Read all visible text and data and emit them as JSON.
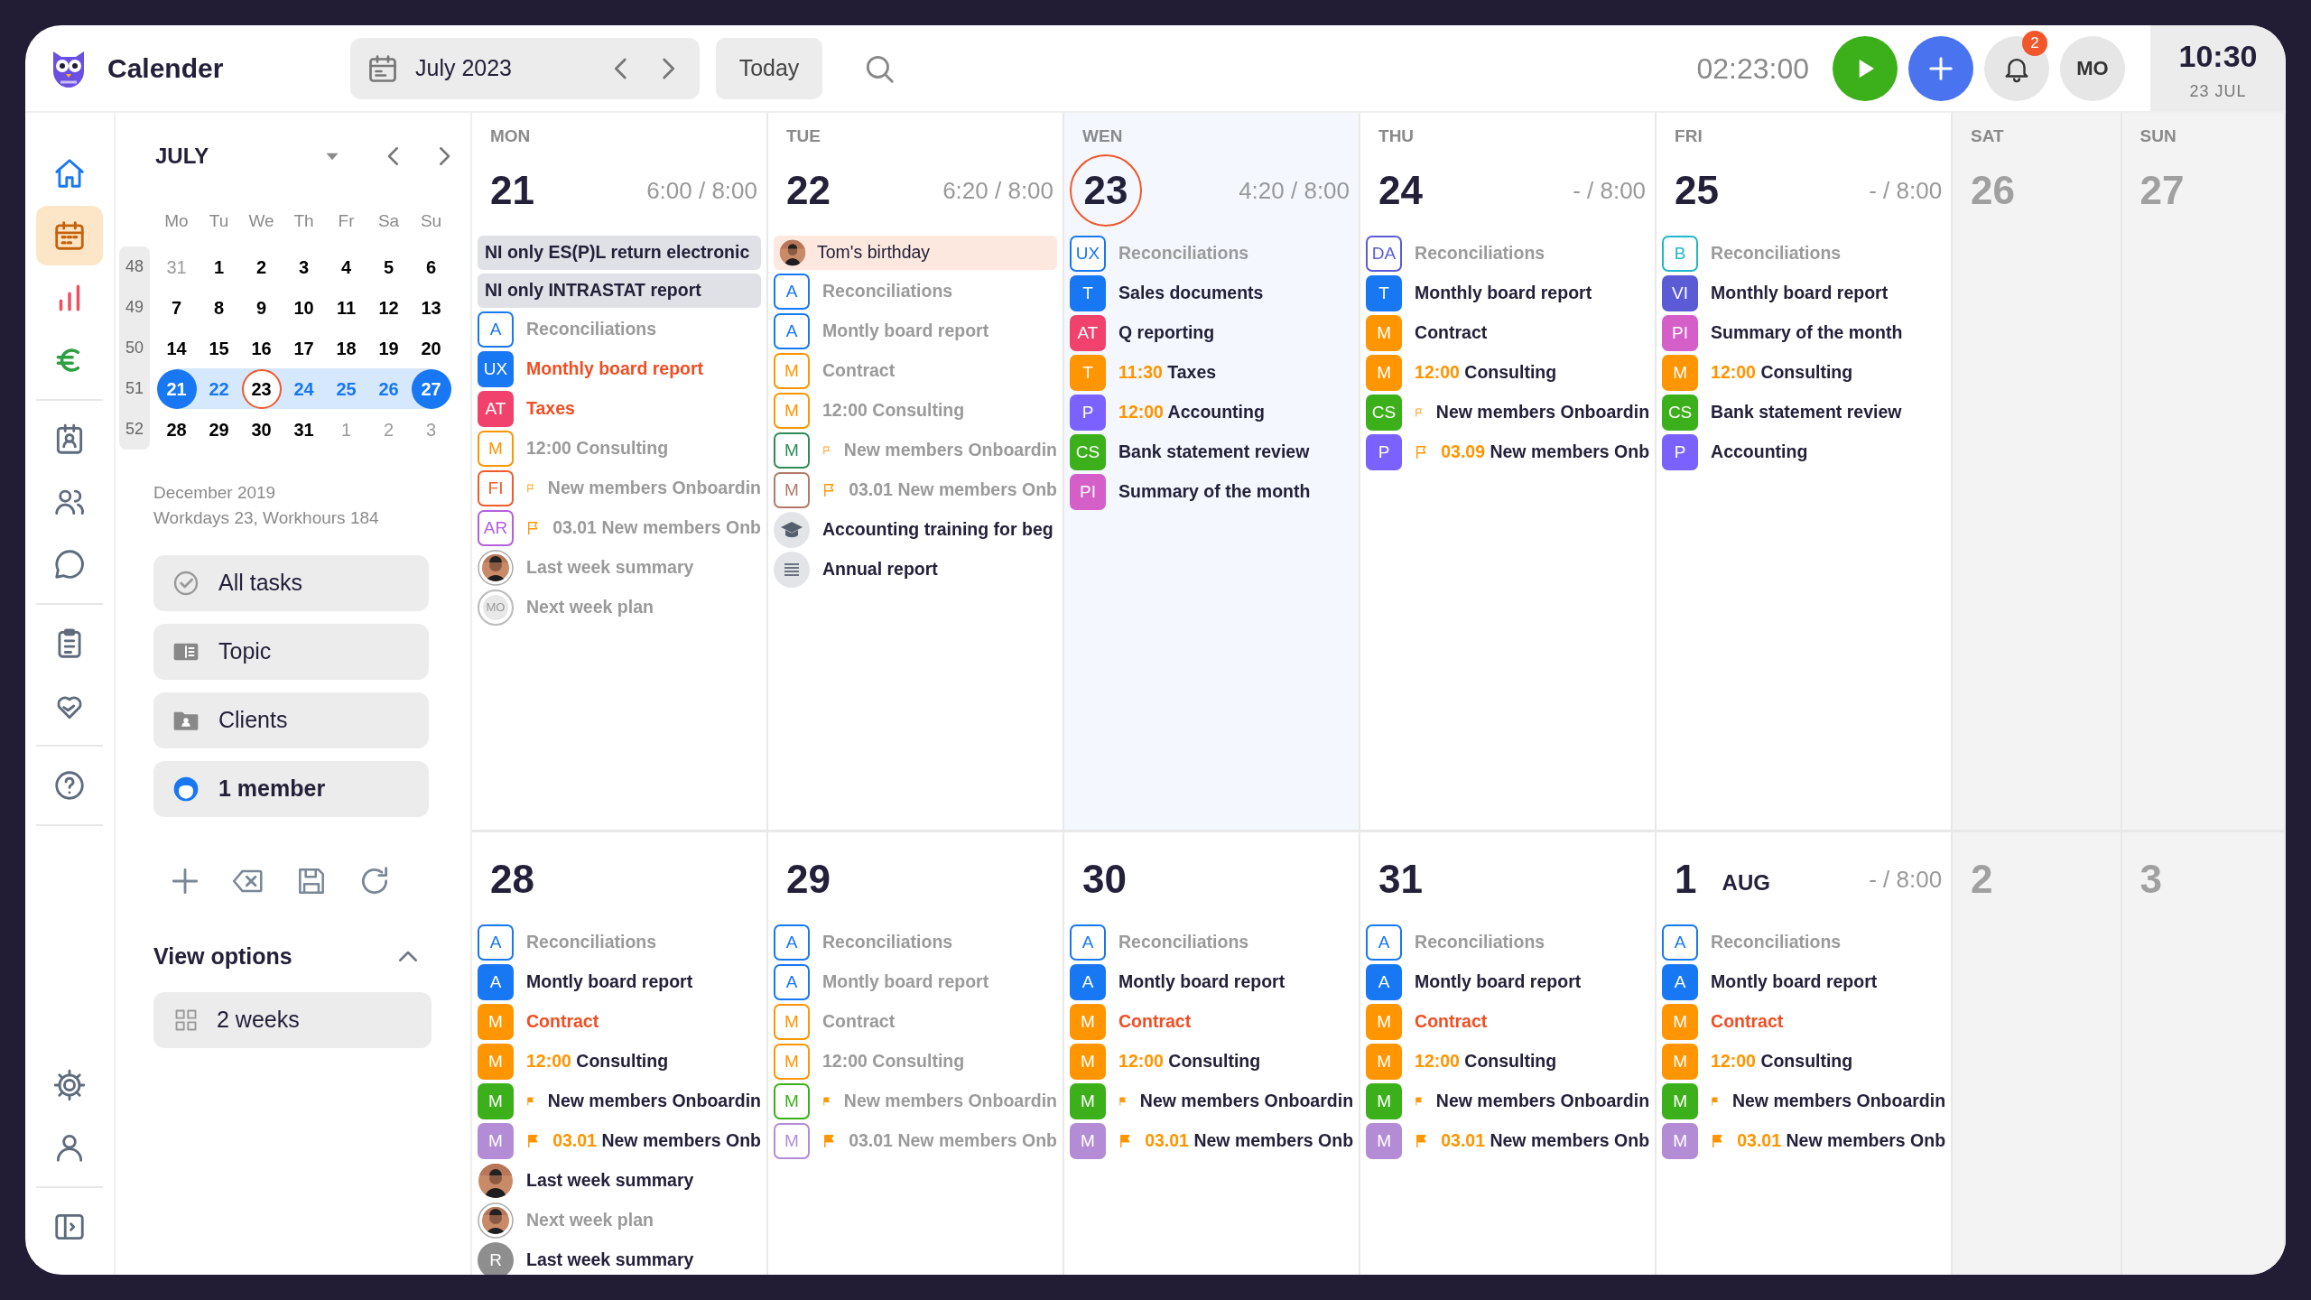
{
  "topbar": {
    "app_title": "Calender",
    "date_picker": "July 2023",
    "today_button": "Today",
    "timer": "02:23:00",
    "notification_count": "2",
    "user_initials": "MO",
    "clock": {
      "time": "10:30",
      "date": "23 JUL"
    }
  },
  "rail": {
    "groups": [
      [
        {
          "selected": false
        },
        {
          "selected": true
        },
        {
          "selected": false
        },
        {
          "selected": false
        }
      ],
      [
        {
          "selected": false
        },
        {
          "selected": false
        },
        {
          "selected": false
        }
      ],
      [
        {
          "selected": false
        },
        {
          "selected": false
        }
      ],
      [
        {
          "selected": false
        }
      ],
      [
        {
          "selected": false
        },
        {
          "selected": false
        }
      ],
      [
        {
          "selected": false
        }
      ]
    ]
  },
  "mini_calendar": {
    "month": "JULY",
    "weekdays": [
      "Mo",
      "Tu",
      "We",
      "Th",
      "Fr",
      "Sa",
      "Su"
    ],
    "weeks": [
      {
        "number": "48",
        "days": [
          {
            "label": "31",
            "kind": "outside"
          },
          {
            "label": "1",
            "kind": "plain"
          },
          {
            "label": "2",
            "kind": "plain"
          },
          {
            "label": "3",
            "kind": "plain"
          },
          {
            "label": "4",
            "kind": "plain"
          },
          {
            "label": "5",
            "kind": "plain"
          },
          {
            "label": "6",
            "kind": "plain"
          }
        ]
      },
      {
        "number": "49",
        "days": [
          {
            "label": "7",
            "kind": "plain"
          },
          {
            "label": "8",
            "kind": "plain"
          },
          {
            "label": "9",
            "kind": "plain"
          },
          {
            "label": "10",
            "kind": "plain"
          },
          {
            "label": "11",
            "kind": "plain"
          },
          {
            "label": "12",
            "kind": "plain"
          },
          {
            "label": "13",
            "kind": "plain"
          }
        ]
      },
      {
        "number": "50",
        "days": [
          {
            "label": "14",
            "kind": "plain"
          },
          {
            "label": "15",
            "kind": "plain"
          },
          {
            "label": "16",
            "kind": "plain"
          },
          {
            "label": "17",
            "kind": "plain"
          },
          {
            "label": "18",
            "kind": "plain"
          },
          {
            "label": "19",
            "kind": "plain"
          },
          {
            "label": "20",
            "kind": "plain"
          }
        ]
      },
      {
        "number": "51",
        "days": [
          {
            "label": "21",
            "kind": "end"
          },
          {
            "label": "22",
            "kind": "range"
          },
          {
            "label": "23",
            "kind": "today"
          },
          {
            "label": "24",
            "kind": "range"
          },
          {
            "label": "25",
            "kind": "range"
          },
          {
            "label": "26",
            "kind": "range"
          },
          {
            "label": "27",
            "kind": "end"
          }
        ]
      },
      {
        "number": "52",
        "days": [
          {
            "label": "28",
            "kind": "plain"
          },
          {
            "label": "29",
            "kind": "plain"
          },
          {
            "label": "30",
            "kind": "plain"
          },
          {
            "label": "31",
            "kind": "plain"
          },
          {
            "label": "1",
            "kind": "outside"
          },
          {
            "label": "2",
            "kind": "outside"
          },
          {
            "label": "3",
            "kind": "outside"
          }
        ]
      }
    ],
    "summary": [
      "December 2019",
      "Workdays 23, Workhours 184"
    ]
  },
  "filters": [
    {
      "label": "All tasks",
      "active": false
    },
    {
      "label": "Topic",
      "active": false
    },
    {
      "label": "Clients",
      "active": false
    },
    {
      "label": "1 member",
      "active": true
    }
  ],
  "view_options": {
    "title": "View options",
    "expanded": true,
    "options": [
      "2 weeks"
    ]
  },
  "weeks": [
    {
      "days": [
        {
          "dow": "MON",
          "number": "21",
          "hours": "6:00 / 8:00",
          "kind": "weekday",
          "today": false,
          "items": [
            {
              "kind": "banner",
              "text": "NI only ES(P)L return electronic"
            },
            {
              "kind": "banner",
              "text": "NI only INTRASTAT report"
            },
            {
              "kind": "task",
              "badge": "A",
              "color": "#1877f2",
              "outlined": true,
              "text": "Reconciliations",
              "done": true,
              "urgent": false
            },
            {
              "kind": "task",
              "badge": "UX",
              "color": "#1877f2",
              "outlined": false,
              "text": "Monthly board report",
              "done": false,
              "urgent": true
            },
            {
              "kind": "task",
              "badge": "AT",
              "color": "#f0426d",
              "outlined": false,
              "text": "Taxes",
              "done": false,
              "urgent": true
            },
            {
              "kind": "task",
              "badge": "M",
              "color": "#ff9500",
              "outlined": true,
              "time": "12:00",
              "text": "Consulting",
              "done": true,
              "urgent": false
            },
            {
              "kind": "task",
              "badge": "FI",
              "color": "#f25a2b",
              "outlined": true,
              "flag": {
                "filled": false
              },
              "text": "New members Onboardin",
              "done": true,
              "urgent": false
            },
            {
              "kind": "task",
              "badge": "AR",
              "color": "#b45fe0",
              "outlined": true,
              "flag": {
                "filled": false
              },
              "time": "03.01",
              "text": "New members Onb",
              "done": true,
              "urgent": false
            },
            {
              "ringed": true,
              "text": "Last week summary",
              "done": true,
              "urgent": false
            },
            {
              "kind": "initials",
              "badge": "MO",
              "outlined": true,
              "text": "Next week plan",
              "done": true,
              "urgent": false
            }
          ]
        },
        {
          "dow": "TUE",
          "number": "22",
          "hours": "6:20 / 8:00",
          "kind": "weekday",
          "today": false,
          "items": [
            {
              "kind": "birthday",
              "text": "Tom's birthday"
            },
            {
              "kind": "task",
              "badge": "A",
              "color": "#1877f2",
              "outlined": true,
              "text": "Reconciliations",
              "done": true,
              "urgent": false
            },
            {
              "kind": "task",
              "badge": "A",
              "color": "#1877f2",
              "outlined": true,
              "text": "Montly board report",
              "done": true,
              "urgent": false
            },
            {
              "kind": "task",
              "badge": "M",
              "color": "#ff9500",
              "outlined": true,
              "text": "Contract",
              "done": true,
              "urgent": false
            },
            {
              "kind": "task",
              "badge": "M",
              "color": "#ff9500",
              "outlined": true,
              "time": "12:00",
              "text": "Consulting",
              "done": true,
              "urgent": false
            },
            {
              "kind": "task",
              "badge": "M",
              "color": "#2e8b57",
              "outlined": true,
              "flag": {
                "filled": false
              },
              "text": "New members Onboardin",
              "done": true,
              "urgent": false
            },
            {
              "kind": "task",
              "badge": "M",
              "color": "#b07a6a",
              "outlined": true,
              "flag": {
                "filled": false
              },
              "time": "03.01",
              "text": "New members Onb",
              "done": true,
              "urgent": false
            },
            {
              "kind": "course",
              "text": "Accounting training for beg",
              "done": false,
              "urgent": false
            },
            {
              "kind": "note",
              "text": "Annual report",
              "done": false,
              "urgent": false
            }
          ]
        },
        {
          "dow": "WEN",
          "number": "23",
          "hours": "4:20 / 8:00",
          "kind": "weekday",
          "today": true,
          "items": [
            {
              "kind": "task",
              "badge": "UX",
              "color": "#1877f2",
              "outlined": true,
              "text": "Reconciliations",
              "done": true,
              "urgent": false
            },
            {
              "kind": "task",
              "badge": "T",
              "color": "#1877f2",
              "outlined": false,
              "text": "Sales documents",
              "done": false,
              "urgent": false
            },
            {
              "kind": "task",
              "badge": "AT",
              "color": "#f0426d",
              "outlined": false,
              "text": "Q reporting",
              "done": false,
              "urgent": false
            },
            {
              "kind": "task",
              "badge": "T",
              "color": "#ff9500",
              "outlined": false,
              "time": "11:30",
              "text": "Taxes",
              "done": false,
              "urgent": false
            },
            {
              "kind": "task",
              "badge": "P",
              "color": "#7b61ff",
              "outlined": false,
              "time": "12:00",
              "text": "Accounting",
              "done": false,
              "urgent": false
            },
            {
              "kind": "task",
              "badge": "CS",
              "color": "#3cb01a",
              "outlined": false,
              "text": "Bank statement review",
              "done": false,
              "urgent": false
            },
            {
              "kind": "task",
              "badge": "PI",
              "color": "#d55fc9",
              "outlined": false,
              "text": "Summary of the month",
              "done": false,
              "urgent": false
            }
          ]
        },
        {
          "dow": "THU",
          "number": "24",
          "hours": "- / 8:00",
          "kind": "weekday",
          "today": false,
          "items": [
            {
              "kind": "task",
              "badge": "DA",
              "color": "#5b5bd6",
              "outlined": true,
              "text": "Reconciliations",
              "done": true,
              "urgent": false
            },
            {
              "kind": "task",
              "badge": "T",
              "color": "#1877f2",
              "outlined": false,
              "text": "Monthly board report",
              "done": false,
              "urgent": false
            },
            {
              "kind": "task",
              "badge": "M",
              "color": "#ff9500",
              "outlined": false,
              "text": "Contract",
              "done": false,
              "urgent": false
            },
            {
              "kind": "task",
              "badge": "M",
              "color": "#ff9500",
              "outlined": false,
              "time": "12:00",
              "text": "Consulting",
              "done": false,
              "urgent": false
            },
            {
              "kind": "task",
              "badge": "CS",
              "color": "#3cb01a",
              "outlined": false,
              "flag": {
                "filled": false
              },
              "text": "New members Onboardin",
              "done": false,
              "urgent": false
            },
            {
              "kind": "task",
              "badge": "P",
              "color": "#7b61ff",
              "outlined": false,
              "flag": {
                "filled": false
              },
              "time": "03.09",
              "text": "New members Onb",
              "done": false,
              "urgent": false
            }
          ]
        },
        {
          "dow": "FRI",
          "number": "25",
          "hours": "- / 8:00",
          "kind": "weekday",
          "today": false,
          "items": [
            {
              "kind": "task",
              "badge": "B",
              "color": "#1fb8c9",
              "outlined": true,
              "text": "Reconciliations",
              "done": true,
              "urgent": false
            },
            {
              "kind": "task",
              "badge": "VI",
              "color": "#5b5bd6",
              "outlined": false,
              "text": "Monthly board report",
              "done": false,
              "urgent": false
            },
            {
              "kind": "task",
              "badge": "PI",
              "color": "#d55fc9",
              "outlined": false,
              "text": "Summary of the month",
              "done": false,
              "urgent": false
            },
            {
              "kind": "task",
              "badge": "M",
              "color": "#ff9500",
              "outlined": false,
              "time": "12:00",
              "text": "Consulting",
              "done": false,
              "urgent": false
            },
            {
              "kind": "task",
              "badge": "CS",
              "color": "#3cb01a",
              "outlined": false,
              "text": "Bank statement review",
              "done": false,
              "urgent": false
            },
            {
              "kind": "task",
              "badge": "P",
              "color": "#7b61ff",
              "outlined": false,
              "text": "Accounting",
              "done": false,
              "urgent": false
            }
          ]
        },
        {
          "dow": "SAT",
          "number": "26",
          "kind": "weekend",
          "today": false
        },
        {
          "dow": "SUN",
          "number": "27",
          "kind": "weekend",
          "today": false
        }
      ]
    },
    {
      "days": [
        {
          "number": "28",
          "kind": "weekday",
          "today": false,
          "items": [
            {
              "kind": "task",
              "badge": "A",
              "color": "#1877f2",
              "outlined": true,
              "text": "Reconciliations",
              "done": true,
              "urgent": false
            },
            {
              "kind": "task",
              "badge": "A",
              "color": "#1877f2",
              "outlined": false,
              "text": "Montly board report",
              "done": false,
              "urgent": false
            },
            {
              "kind": "task",
              "badge": "M",
              "color": "#ff9500",
              "outlined": false,
              "text": "Contract",
              "done": false,
              "urgent": true
            },
            {
              "kind": "task",
              "badge": "M",
              "color": "#ff9500",
              "outlined": false,
              "time": "12:00",
              "text": "Consulting",
              "done": false,
              "urgent": false
            },
            {
              "kind": "task",
              "badge": "M",
              "color": "#3cb01a",
              "outlined": false,
              "flag": {
                "filled": true
              },
              "text": "New members Onboardin",
              "done": false,
              "urgent": false
            },
            {
              "kind": "task",
              "badge": "M",
              "color": "#b48cd6",
              "outlined": false,
              "flag": {
                "filled": true
              },
              "time": "03.01",
              "text": "New members Onb",
              "done": false,
              "urgent": false
            },
            {
              "ringed": false,
              "text": "Last week summary",
              "done": false,
              "urgent": false
            },
            {
              "ringed": true,
              "text": "Next week plan",
              "done": true,
              "urgent": false
            },
            {
              "kind": "initials",
              "badge": "R",
              "outlined": false,
              "text": "Last week summary",
              "done": false,
              "urgent": false
            }
          ]
        },
        {
          "number": "29",
          "kind": "weekday",
          "today": false,
          "items": [
            {
              "kind": "task",
              "badge": "A",
              "color": "#1877f2",
              "outlined": true,
              "text": "Reconciliations",
              "done": true,
              "urgent": false
            },
            {
              "kind": "task",
              "badge": "A",
              "color": "#1877f2",
              "outlined": true,
              "text": "Montly board report",
              "done": true,
              "urgent": false
            },
            {
              "kind": "task",
              "badge": "M",
              "color": "#ff9500",
              "outlined": true,
              "text": "Contract",
              "done": true,
              "urgent": false
            },
            {
              "kind": "task",
              "badge": "M",
              "color": "#ff9500",
              "outlined": true,
              "time": "12:00",
              "text": "Consulting",
              "done": true,
              "urgent": false
            },
            {
              "kind": "task",
              "badge": "M",
              "color": "#3cb01a",
              "outlined": true,
              "flag": {
                "filled": true
              },
              "text": "New members Onboardin",
              "done": true,
              "urgent": false
            },
            {
              "kind": "task",
              "badge": "M",
              "color": "#b48cd6",
              "outlined": true,
              "flag": {
                "filled": true
              },
              "time": "03.01",
              "text": "New members Onb",
              "done": true,
              "urgent": false
            }
          ]
        },
        {
          "number": "30",
          "kind": "weekday",
          "today": false,
          "items": [
            {
              "kind": "task",
              "badge": "A",
              "color": "#1877f2",
              "outlined": true,
              "text": "Reconciliations",
              "done": true,
              "urgent": false
            },
            {
              "kind": "task",
              "badge": "A",
              "color": "#1877f2",
              "outlined": false,
              "text": "Montly board report",
              "done": false,
              "urgent": false
            },
            {
              "kind": "task",
              "badge": "M",
              "color": "#ff9500",
              "outlined": false,
              "text": "Contract",
              "done": false,
              "urgent": true
            },
            {
              "kind": "task",
              "badge": "M",
              "color": "#ff9500",
              "outlined": false,
              "time": "12:00",
              "text": "Consulting",
              "done": false,
              "urgent": false
            },
            {
              "kind": "task",
              "badge": "M",
              "color": "#3cb01a",
              "outlined": false,
              "flag": {
                "filled": true
              },
              "text": "New members Onboardin",
              "done": false,
              "urgent": false
            },
            {
              "kind": "task",
              "badge": "M",
              "color": "#b48cd6",
              "outlined": false,
              "flag": {
                "filled": true
              },
              "time": "03.01",
              "text": "New members Onb",
              "done": false,
              "urgent": false
            }
          ]
        },
        {
          "number": "31",
          "kind": "weekday",
          "today": false,
          "items": [
            {
              "kind": "task",
              "badge": "A",
              "color": "#1877f2",
              "outlined": true,
              "text": "Reconciliations",
              "done": true,
              "urgent": false
            },
            {
              "kind": "task",
              "badge": "A",
              "color": "#1877f2",
              "outlined": false,
              "text": "Montly board report",
              "done": false,
              "urgent": false
            },
            {
              "kind": "task",
              "badge": "M",
              "color": "#ff9500",
              "outlined": false,
              "text": "Contract",
              "done": false,
              "urgent": true
            },
            {
              "kind": "task",
              "badge": "M",
              "color": "#ff9500",
              "outlined": false,
              "time": "12:00",
              "text": "Consulting",
              "done": false,
              "urgent": false
            },
            {
              "kind": "task",
              "badge": "M",
              "color": "#3cb01a",
              "outlined": false,
              "flag": {
                "filled": true
              },
              "text": "New members Onboardin",
              "done": false,
              "urgent": false
            },
            {
              "kind": "task",
              "badge": "M",
              "color": "#b48cd6",
              "outlined": false,
              "flag": {
                "filled": true
              },
              "time": "03.01",
              "text": "New members Onb",
              "done": false,
              "urgent": false
            }
          ]
        },
        {
          "number": "1",
          "month": "AUG",
          "hours": "- / 8:00",
          "kind": "weekday",
          "today": false,
          "items": [
            {
              "kind": "task",
              "badge": "A",
              "color": "#1877f2",
              "outlined": true,
              "text": "Reconciliations",
              "done": true,
              "urgent": false
            },
            {
              "kind": "task",
              "badge": "A",
              "color": "#1877f2",
              "outlined": false,
              "text": "Montly board report",
              "done": false,
              "urgent": false
            },
            {
              "kind": "task",
              "badge": "M",
              "color": "#ff9500",
              "outlined": false,
              "text": "Contract",
              "done": false,
              "urgent": true
            },
            {
              "kind": "task",
              "badge": "M",
              "color": "#ff9500",
              "outlined": false,
              "time": "12:00",
              "text": "Consulting",
              "done": false,
              "urgent": false
            },
            {
              "kind": "task",
              "badge": "M",
              "color": "#3cb01a",
              "outlined": false,
              "flag": {
                "filled": true
              },
              "text": "New members Onboardin",
              "done": false,
              "urgent": false
            },
            {
              "kind": "task",
              "badge": "M",
              "color": "#b48cd6",
              "outlined": false,
              "flag": {
                "filled": true
              },
              "time": "03.01",
              "text": "New members Onb",
              "done": false,
              "urgent": false
            }
          ]
        },
        {
          "number": "2",
          "kind": "weekend",
          "today": false
        },
        {
          "number": "3",
          "kind": "weekend",
          "today": false
        }
      ]
    }
  ]
}
